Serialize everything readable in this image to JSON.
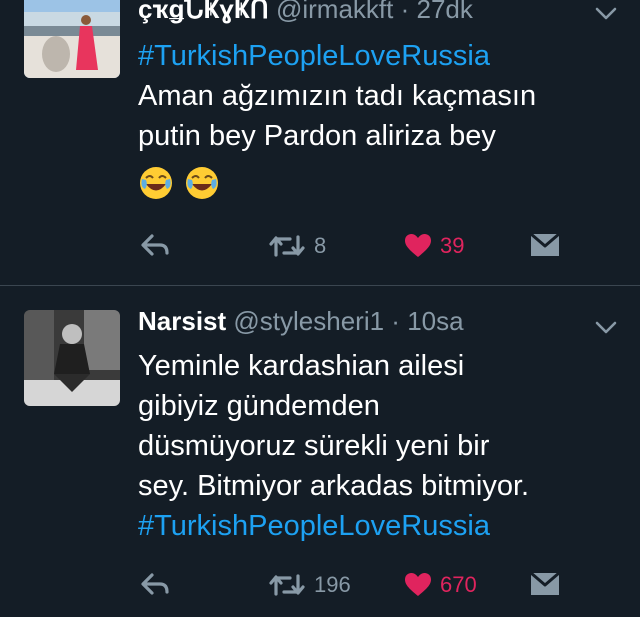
{
  "tweets": [
    {
      "display_name": "çҡǥՆҜɣҜՈ",
      "handle": "@irmakkft",
      "dot": "·",
      "time": "27dk",
      "body_lines": [
        "#TurkishPeopleLoveRussia",
        "Aman ağzımızın tadı kaçmasın",
        "putin bey  Pardon aliriza bey"
      ],
      "emojis": [
        "face-with-tears-of-joy-icon",
        "face-with-tears-of-joy-icon"
      ],
      "retweet_count": "8",
      "like_count": "39"
    },
    {
      "display_name": "Narsist",
      "handle": "@stylesheri1",
      "dot": "·",
      "time": "10sa",
      "body_lines": [
        "Yeminle kardashian ailesi",
        "gibiyiz gündemden",
        "düsmüyoruz sürekli yeni bir",
        "sey. Bitmiyor arkadas bitmiyor.",
        "#TurkishPeopleLoveRussia"
      ],
      "retweet_count": "196",
      "like_count": "670"
    }
  ],
  "icons": {
    "reply": "reply-icon",
    "retweet": "retweet-icon",
    "like": "heart-icon",
    "dm": "direct-message-icon",
    "more": "chevron-down-icon"
  },
  "colors": {
    "background": "#141d26",
    "hashtag": "#1da1f2",
    "muted": "#8899a6",
    "like": "#e0245e"
  }
}
